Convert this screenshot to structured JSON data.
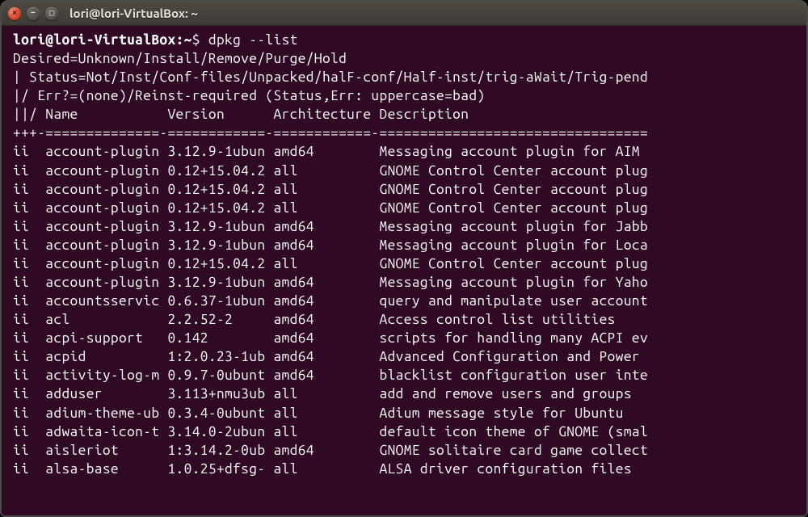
{
  "window": {
    "title": "lori@lori-VirtualBox: ~"
  },
  "prompt": {
    "user_host": "lori@lori-VirtualBox",
    "separator": ":",
    "path": "~",
    "dollar": "$",
    "command": "dpkg --list"
  },
  "header": {
    "l1": "Desired=Unknown/Install/Remove/Purge/Hold",
    "l2": "| Status=Not/Inst/Conf-files/Unpacked/halF-conf/Half-inst/trig-aWait/Trig-pend",
    "l3": "|/ Err?=(none)/Reinst-required (Status,Err: uppercase=bad)",
    "cols": "||/ Name           Version      Architecture Description",
    "sep": "+++-==============-============-============-================================="
  },
  "packages": [
    {
      "st": "ii",
      "name": "account-plugin",
      "ver": "3.12.9-1ubun",
      "arch": "amd64",
      "desc": "Messaging account plugin for AIM"
    },
    {
      "st": "ii",
      "name": "account-plugin",
      "ver": "0.12+15.04.2",
      "arch": "all",
      "desc": "GNOME Control Center account plug"
    },
    {
      "st": "ii",
      "name": "account-plugin",
      "ver": "0.12+15.04.2",
      "arch": "all",
      "desc": "GNOME Control Center account plug"
    },
    {
      "st": "ii",
      "name": "account-plugin",
      "ver": "0.12+15.04.2",
      "arch": "all",
      "desc": "GNOME Control Center account plug"
    },
    {
      "st": "ii",
      "name": "account-plugin",
      "ver": "3.12.9-1ubun",
      "arch": "amd64",
      "desc": "Messaging account plugin for Jabb"
    },
    {
      "st": "ii",
      "name": "account-plugin",
      "ver": "3.12.9-1ubun",
      "arch": "amd64",
      "desc": "Messaging account plugin for Loca"
    },
    {
      "st": "ii",
      "name": "account-plugin",
      "ver": "0.12+15.04.2",
      "arch": "all",
      "desc": "GNOME Control Center account plug"
    },
    {
      "st": "ii",
      "name": "account-plugin",
      "ver": "3.12.9-1ubun",
      "arch": "amd64",
      "desc": "Messaging account plugin for Yaho"
    },
    {
      "st": "ii",
      "name": "accountsservic",
      "ver": "0.6.37-1ubun",
      "arch": "amd64",
      "desc": "query and manipulate user account"
    },
    {
      "st": "ii",
      "name": "acl",
      "ver": "2.2.52-2",
      "arch": "amd64",
      "desc": "Access control list utilities"
    },
    {
      "st": "ii",
      "name": "acpi-support",
      "ver": "0.142",
      "arch": "amd64",
      "desc": "scripts for handling many ACPI ev"
    },
    {
      "st": "ii",
      "name": "acpid",
      "ver": "1:2.0.23-1ub",
      "arch": "amd64",
      "desc": "Advanced Configuration and Power "
    },
    {
      "st": "ii",
      "name": "activity-log-m",
      "ver": "0.9.7-0ubunt",
      "arch": "amd64",
      "desc": "blacklist configuration user inte"
    },
    {
      "st": "ii",
      "name": "adduser",
      "ver": "3.113+nmu3ub",
      "arch": "all",
      "desc": "add and remove users and groups"
    },
    {
      "st": "ii",
      "name": "adium-theme-ub",
      "ver": "0.3.4-0ubunt",
      "arch": "all",
      "desc": "Adium message style for Ubuntu"
    },
    {
      "st": "ii",
      "name": "adwaita-icon-t",
      "ver": "3.14.0-2ubun",
      "arch": "all",
      "desc": "default icon theme of GNOME (smal"
    },
    {
      "st": "ii",
      "name": "aisleriot",
      "ver": "1:3.14.2-0ub",
      "arch": "amd64",
      "desc": "GNOME solitaire card game collect"
    },
    {
      "st": "ii",
      "name": "alsa-base",
      "ver": "1.0.25+dfsg-",
      "arch": "all",
      "desc": "ALSA driver configuration files"
    }
  ],
  "columns": {
    "st_w": 4,
    "name_w": 15,
    "ver_w": 13,
    "arch_w": 13
  }
}
